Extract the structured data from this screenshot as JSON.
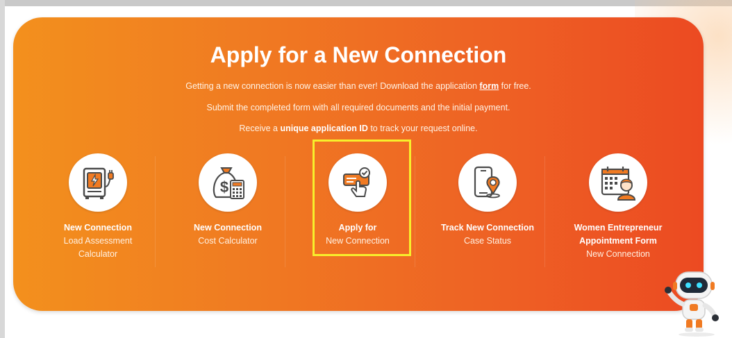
{
  "banner": {
    "title": "Apply for a New Connection",
    "intro": {
      "line1_pre": "Getting a new connection is now easier than ever! Download the application ",
      "line1_link": "form",
      "line1_post": " for free.",
      "line2": "Submit the completed form with all required documents and the initial payment.",
      "line3_pre": "Receive a ",
      "line3_bold": "unique application ID",
      "line3_post": " to track your request online."
    },
    "cards": [
      {
        "bold": "New Connection",
        "sub": "Load Assessment Calculator",
        "icon": "load-assessment-icon"
      },
      {
        "bold": "New Connection",
        "sub": "Cost Calculator",
        "icon": "money-bag-calculator-icon"
      },
      {
        "bold": "Apply for",
        "sub": "New Connection",
        "icon": "hand-click-form-icon"
      },
      {
        "bold": "Track New Connection",
        "sub": "Case Status",
        "icon": "phone-location-icon"
      },
      {
        "bold": "Women Entrepreneur Appointment Form",
        "sub": "New Connection",
        "icon": "calendar-woman-icon"
      }
    ]
  },
  "colors": {
    "banner_start": "#f3901d",
    "banner_end": "#ec4a22",
    "highlight": "#f7ef2c",
    "icon_dark": "#4a4a4a",
    "icon_orange": "#f07a22"
  },
  "assistant": {
    "icon": "robot-assistant-icon"
  }
}
